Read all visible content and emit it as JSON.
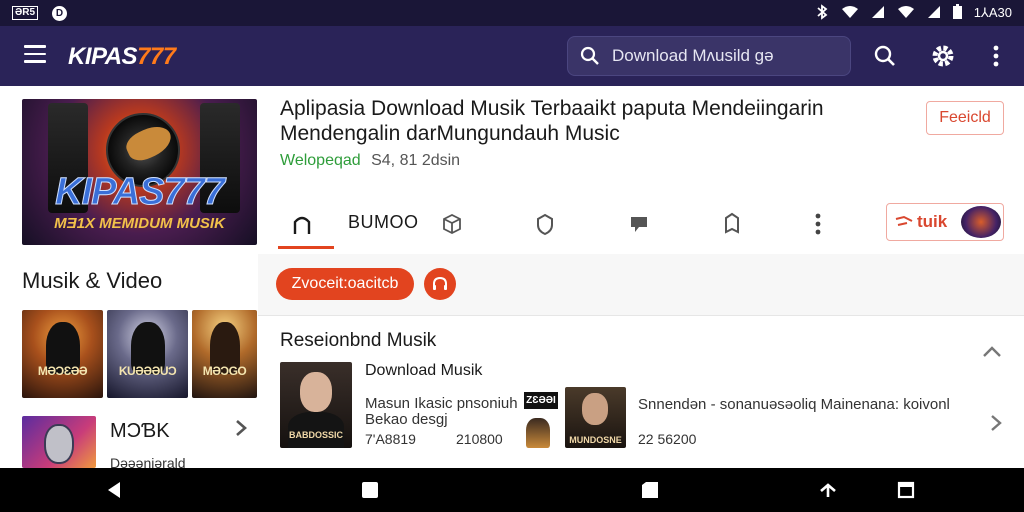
{
  "status_bar": {
    "left_badge": "ƏR5",
    "left_icon": "D",
    "time": "1⅄A30"
  },
  "app_bar": {
    "logo_text": "KIPAS",
    "logo_number": "777",
    "search_text": "Download Mʌusild gə",
    "icons": [
      "menu-icon",
      "search-icon",
      "gear-icon",
      "more-vert-icon"
    ]
  },
  "hero": {
    "title": "KIPAS777",
    "subtitle": "MƎ1X MEMIDUM MUSIK"
  },
  "left": {
    "section_title": "Musik & Video",
    "thumbs": [
      {
        "label": "MƏƆƐƏƏ"
      },
      {
        "label": "KUƏƏƏUƆ"
      },
      {
        "label": "MƏƆGO"
      }
    ],
    "list_item": {
      "title": "MƆƁK",
      "subtitle": "Dəəəniərald"
    }
  },
  "app_info": {
    "title": "Aplipasia Download Musik  Terbaaikt paputa Mendeiingarin Mendengalin darMungundauh Music",
    "developer": "Welopeqad",
    "stats": "S4, 81 2dsin",
    "feed_badge": "Feeicld"
  },
  "tabs": {
    "active_label": "BUMOO",
    "icons": [
      "home-icon",
      "cube-icon",
      "shield-icon",
      "comment-icon",
      "bookmark-icon",
      "more-vert-icon"
    ],
    "promo_text": "tuik"
  },
  "chips": {
    "primary": "Zvoceit:oacitcb"
  },
  "recommended": {
    "title": "Reseionbnd Musik",
    "item1": {
      "thumb_label": "BABDOSSIC",
      "title": "Download Musik",
      "desc": "Masun Ikasic pnsoniuh Bekao desgj",
      "count1": "7'A8819",
      "count2": "210800"
    },
    "mini_badge": "ZƐƏƏI",
    "item2": {
      "thumb_label": "MUNDOSNE",
      "desc": "Snnendən - sonanuəsəoliq Mainenana: koivonl",
      "count": "22 56200"
    }
  },
  "colors": {
    "app_bar": "#2a2358",
    "accent": "#e2441f",
    "logo_accent": "#ff7a1a",
    "developer": "#2e9d3a"
  }
}
